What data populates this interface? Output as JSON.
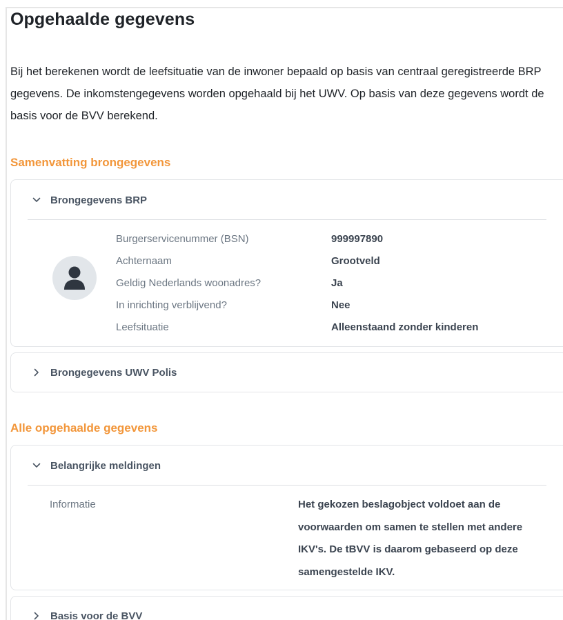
{
  "page": {
    "title": "Opgehaalde gegevens",
    "intro": "Bij het berekenen wordt de leefsituatie van de inwoner bepaald op basis van centraal geregistreerde BRP gegevens. De inkomstengegevens worden opgehaald bij het UWV. Op basis van deze gegevens wordt de basis voor de BVV berekend."
  },
  "summary": {
    "title": "Samenvatting brongegevens",
    "brp": {
      "header": "Brongegevens BRP",
      "avatar_icon": "user-icon",
      "rows": [
        {
          "label": "Burgerservicenummer (BSN)",
          "value": "999997890"
        },
        {
          "label": "Achternaam",
          "value": "Grootveld"
        },
        {
          "label": "Geldig Nederlands woonadres?",
          "value": "Ja"
        },
        {
          "label": "In inrichting verblijvend?",
          "value": "Nee"
        },
        {
          "label": "Leefsituatie",
          "value": "Alleenstaand zonder kinderen"
        }
      ]
    },
    "uwv": {
      "header": "Brongegevens UWV Polis"
    }
  },
  "all": {
    "title": "Alle opgehaalde gegevens",
    "meldingen": {
      "header": "Belangrijke meldingen",
      "label": "Informatie",
      "value": "Het gekozen beslagobject voldoet aan de voorwaarden om samen te stellen met andere IKV's. De tBVV is daarom gebaseerd op deze samengestelde IKV."
    },
    "bvv": {
      "header": "Basis voor de BVV"
    }
  },
  "colors": {
    "accent": "#f2963a",
    "label": "#6b7682",
    "value": "#3b4450",
    "border": "#e3e5e8"
  }
}
